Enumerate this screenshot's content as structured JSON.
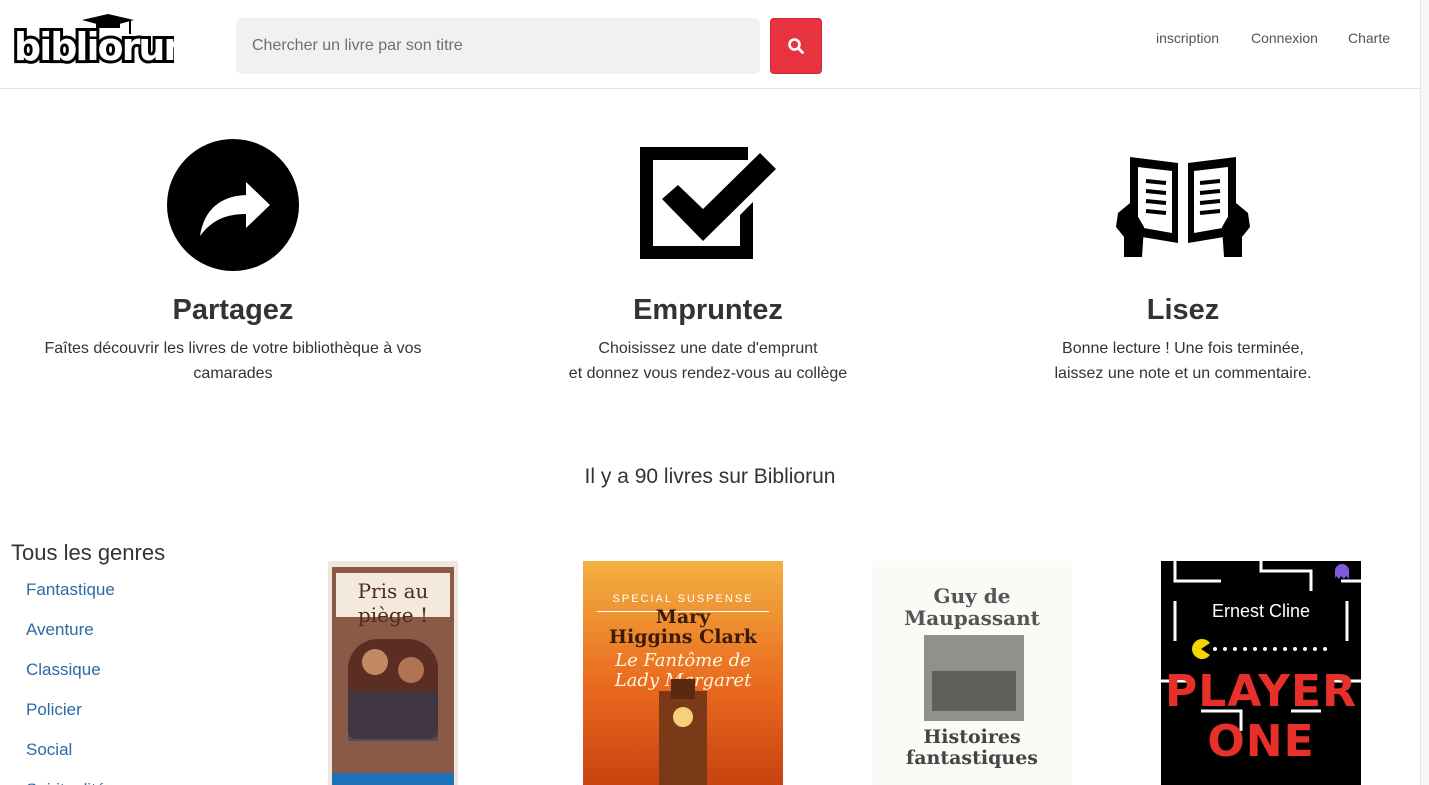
{
  "header": {
    "logo_text": "bibliorun",
    "search_placeholder": "Chercher un livre par son titre",
    "nav": [
      "inscription",
      "Connexion",
      "Charte"
    ]
  },
  "colors": {
    "accent": "#e7323f",
    "link": "#2a6aa8",
    "text": "#333333"
  },
  "features": [
    {
      "icon": "share-arrow-icon",
      "title": "Partagez",
      "text": "Faîtes découvrir les livres de votre bibliothèque à vos\ncamarades"
    },
    {
      "icon": "checkbox-icon",
      "title": "Empruntez",
      "text": "Choisissez une date d'emprunt\net donnez vous rendez-vous au collège"
    },
    {
      "icon": "open-book-icon",
      "title": "Lisez",
      "text": "Bonne lecture ! Une fois terminée,\nlaissez une note et un commentaire."
    }
  ],
  "book_count_text": "Il y a 90 livres sur Bibliorun",
  "sidebar": {
    "title": "Tous les genres",
    "genres": [
      "Fantastique",
      "Aventure",
      "Classique",
      "Policier",
      "Social",
      "Spiritualité"
    ]
  },
  "books": [
    {
      "cover_title": "Pris au piège !"
    },
    {
      "cover_banner": "SPECIAL SUSPENSE",
      "cover_author": "Mary\nHiggins Clark",
      "cover_title": "Le Fantôme de\nLady Margaret"
    },
    {
      "cover_author": "Guy de\nMaupassant",
      "cover_title": "Histoires\nfantastiques"
    },
    {
      "cover_author": "Ernest Cline",
      "cover_title": "PLAYER\nONE"
    }
  ]
}
